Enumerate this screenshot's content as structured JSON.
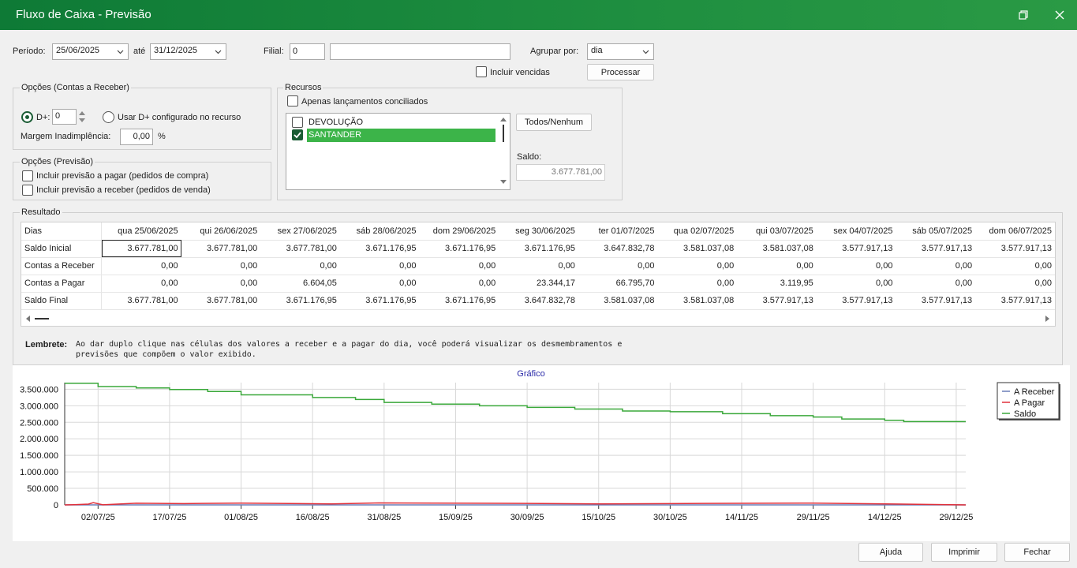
{
  "window": {
    "title": "Fluxo de Caixa - Previsão"
  },
  "filters": {
    "periodo_label": "Período:",
    "periodo_start": "25/06/2025",
    "ate_label": "até",
    "periodo_end": "31/12/2025",
    "filial_label": "Filial:",
    "filial_code": "0",
    "filial_name": "",
    "agrupar_label": "Agrupar por:",
    "agrupar_value": "dia",
    "incluir_vencidas": "Incluir vencidas",
    "processar": "Processar"
  },
  "receber": {
    "title": "Opções (Contas a Receber)",
    "dplus_label": "D+:",
    "dplus_value": "0",
    "usar_dplus": "Usar D+ configurado no recurso",
    "margem_label": "Margem Inadimplência:",
    "margem_value": "0,00",
    "pct": "%"
  },
  "previsao": {
    "title": "Opções (Previsão)",
    "pagar": "Incluir previsão a pagar (pedidos de compra)",
    "receber": "Incluir previsão a receber (pedidos de venda)"
  },
  "recursos": {
    "title": "Recursos",
    "conciliados": "Apenas lançamentos conciliados",
    "items": [
      {
        "label": "DEVOLUÇÃO",
        "checked": false
      },
      {
        "label": "SANTANDER",
        "checked": true
      }
    ],
    "todos": "Todos/Nenhum",
    "saldo_label": "Saldo:",
    "saldo_value": "3.677.781,00"
  },
  "resultado": {
    "title": "Resultado",
    "dias_label": "Dias",
    "columns": [
      "qua 25/06/2025",
      "qui 26/06/2025",
      "sex 27/06/2025",
      "sáb 28/06/2025",
      "dom 29/06/2025",
      "seg 30/06/2025",
      "ter 01/07/2025",
      "qua 02/07/2025",
      "qui 03/07/2025",
      "sex 04/07/2025",
      "sáb 05/07/2025",
      "dom 06/07/2025"
    ],
    "rows": [
      {
        "label": "Saldo Inicial",
        "values": [
          "3.677.781,00",
          "3.677.781,00",
          "3.677.781,00",
          "3.671.176,95",
          "3.671.176,95",
          "3.671.176,95",
          "3.647.832,78",
          "3.581.037,08",
          "3.581.037,08",
          "3.577.917,13",
          "3.577.917,13",
          "3.577.917,13"
        ]
      },
      {
        "label": "Contas a Receber",
        "values": [
          "0,00",
          "0,00",
          "0,00",
          "0,00",
          "0,00",
          "0,00",
          "0,00",
          "0,00",
          "0,00",
          "0,00",
          "0,00",
          "0,00"
        ]
      },
      {
        "label": "Contas a Pagar",
        "values": [
          "0,00",
          "0,00",
          "6.604,05",
          "0,00",
          "0,00",
          "23.344,17",
          "66.795,70",
          "0,00",
          "3.119,95",
          "0,00",
          "0,00",
          "0,00"
        ]
      },
      {
        "label": "Saldo Final",
        "values": [
          "3.677.781,00",
          "3.677.781,00",
          "3.671.176,95",
          "3.671.176,95",
          "3.671.176,95",
          "3.647.832,78",
          "3.581.037,08",
          "3.581.037,08",
          "3.577.917,13",
          "3.577.917,13",
          "3.577.917,13",
          "3.577.917,13"
        ]
      }
    ]
  },
  "lembrete": {
    "label": "Lembrete:",
    "line1": "Ao dar duplo clique nas células dos valores a receber e a pagar do dia, você poderá visualizar os desmembramentos e",
    "line2": "previsões que compõem o valor exibido."
  },
  "chart_data": {
    "type": "line",
    "title": "Gráfico",
    "x_ticks": [
      "02/07/25",
      "17/07/25",
      "01/08/25",
      "16/08/25",
      "31/08/25",
      "15/09/25",
      "30/09/25",
      "15/10/25",
      "30/10/25",
      "14/11/25",
      "29/11/25",
      "14/12/25",
      "29/12/25"
    ],
    "y_ticks": [
      "3.500.000",
      "3.000.000",
      "2.500.000",
      "2.000.000",
      "1.500.000",
      "1.000.000",
      "500.000",
      "0"
    ],
    "ylim": [
      0,
      3700000
    ],
    "x_range": [
      "25/06/2025",
      "31/12/2025"
    ],
    "legend_position": "top-right",
    "series": [
      {
        "name": "A Receber",
        "color": "#6b7fb8",
        "points": [
          [
            "25/06/2025",
            0
          ],
          [
            "31/12/2025",
            0
          ]
        ]
      },
      {
        "name": "A Pagar",
        "color": "#e0303a",
        "points": [
          [
            "25/06/2025",
            0
          ],
          [
            "27/06/2025",
            6604
          ],
          [
            "30/06/2025",
            23344
          ],
          [
            "01/07/2025",
            66796
          ],
          [
            "03/07/2025",
            3120
          ],
          [
            "10/07/2025",
            50000
          ],
          [
            "20/07/2025",
            40000
          ],
          [
            "01/08/2025",
            55000
          ],
          [
            "20/08/2025",
            30000
          ],
          [
            "30/08/2025",
            60000
          ],
          [
            "30/09/2025",
            45000
          ],
          [
            "15/10/2025",
            30000
          ],
          [
            "30/10/2025",
            40000
          ],
          [
            "29/11/2025",
            55000
          ],
          [
            "14/12/2025",
            30000
          ],
          [
            "31/12/2025",
            0
          ]
        ]
      },
      {
        "name": "Saldo",
        "color": "#3aa83a",
        "points": [
          [
            "25/06/2025",
            3677781
          ],
          [
            "02/07/2025",
            3581037
          ],
          [
            "10/07/2025",
            3540000
          ],
          [
            "17/07/2025",
            3490000
          ],
          [
            "25/07/2025",
            3430000
          ],
          [
            "01/08/2025",
            3330000
          ],
          [
            "16/08/2025",
            3250000
          ],
          [
            "25/08/2025",
            3190000
          ],
          [
            "31/08/2025",
            3100000
          ],
          [
            "10/09/2025",
            3050000
          ],
          [
            "20/09/2025",
            3000000
          ],
          [
            "30/09/2025",
            2950000
          ],
          [
            "10/10/2025",
            2900000
          ],
          [
            "20/10/2025",
            2840000
          ],
          [
            "30/10/2025",
            2820000
          ],
          [
            "10/11/2025",
            2760000
          ],
          [
            "20/11/2025",
            2700000
          ],
          [
            "29/11/2025",
            2660000
          ],
          [
            "05/12/2025",
            2600000
          ],
          [
            "14/12/2025",
            2560000
          ],
          [
            "18/12/2025",
            2520000
          ],
          [
            "31/12/2025",
            2520000
          ]
        ]
      }
    ]
  },
  "footer": {
    "ajuda": "Ajuda",
    "imprimir": "Imprimir",
    "fechar": "Fechar"
  }
}
